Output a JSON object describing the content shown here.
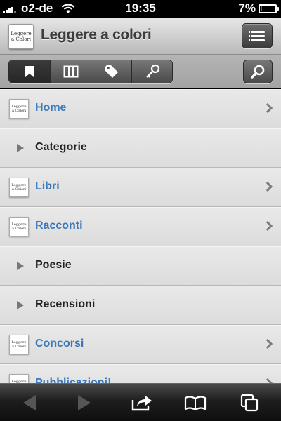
{
  "status_bar": {
    "carrier": "o2-de",
    "time": "19:35",
    "battery": "7%",
    "battery_level": 0.07
  },
  "header": {
    "title": "Leggere a colori",
    "logo_text": "Leggere a Colori"
  },
  "toolbar": {
    "tabs": [
      {
        "icon": "bookmark-icon",
        "active": true
      },
      {
        "icon": "columns-icon",
        "active": false
      },
      {
        "icon": "tag-icon",
        "active": false
      },
      {
        "icon": "key-icon",
        "active": false
      }
    ],
    "search_icon": "search-icon"
  },
  "list": {
    "items": [
      {
        "label": "Home",
        "type": "link"
      },
      {
        "label": "Categorie",
        "type": "category"
      },
      {
        "label": "Libri",
        "type": "link"
      },
      {
        "label": "Racconti",
        "type": "link"
      },
      {
        "label": "Poesie",
        "type": "category"
      },
      {
        "label": "Recensioni",
        "type": "category"
      },
      {
        "label": "Concorsi",
        "type": "link"
      },
      {
        "label": "Pubblicazioni!",
        "type": "link"
      }
    ],
    "link_color": "#3c79b8"
  },
  "bottom_bar": {
    "icons": [
      "back-icon",
      "forward-icon",
      "share-icon",
      "bookmarks-icon",
      "tabs-icon"
    ]
  }
}
